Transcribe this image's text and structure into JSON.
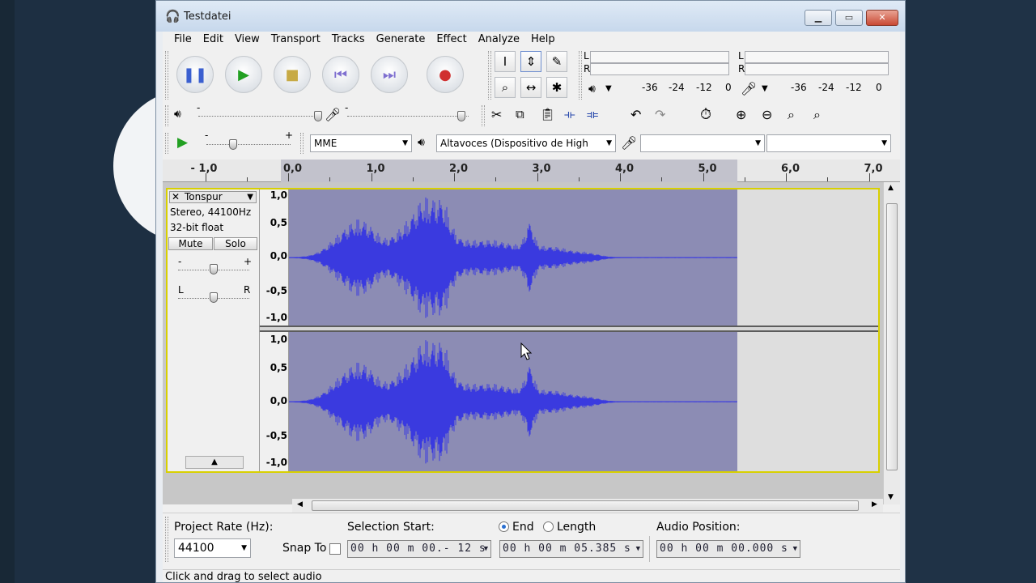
{
  "window": {
    "title": "Testdatei"
  },
  "menu": [
    "File",
    "Edit",
    "View",
    "Transport",
    "Tracks",
    "Generate",
    "Effect",
    "Analyze",
    "Help"
  ],
  "transport_buttons": [
    {
      "name": "pause-button",
      "glyph": "❚❚",
      "color": "#3a5fd0"
    },
    {
      "name": "play-button",
      "glyph": "▶",
      "color": "#22a022"
    },
    {
      "name": "stop-button",
      "glyph": "■",
      "color": "#c7aa45"
    },
    {
      "name": "skip-start-button",
      "glyph": "⏮",
      "color": "#7f70d0"
    },
    {
      "name": "skip-end-button",
      "glyph": "⏭",
      "color": "#7f70d0"
    },
    {
      "name": "record-button",
      "glyph": "●",
      "color": "#d03030"
    }
  ],
  "tools": {
    "selection": "I",
    "envelope": "⇕",
    "draw": "✎",
    "zoom": "⌕",
    "timeshift": "↔",
    "multi": "✱"
  },
  "meters": {
    "play_L": "L",
    "play_R": "R",
    "rec_L": "L",
    "rec_R": "R",
    "play_scale": [
      "-36",
      "-24",
      "-12",
      "0"
    ],
    "rec_scale": [
      "-36",
      "-24",
      "-12",
      "0"
    ]
  },
  "mixer": {
    "minus": "-",
    "plus": "+"
  },
  "device_toolbar": {
    "host": "MME",
    "output": "Altavoces (Dispositivo de High",
    "input": "",
    "channels": ""
  },
  "ruler": {
    "labels": [
      "- 1,0",
      "0,0",
      "1,0",
      "2,0",
      "3,0",
      "4,0",
      "5,0",
      "6,0",
      "7,0"
    ]
  },
  "track": {
    "name": "Tonspur",
    "info_line1": "Stereo, 44100Hz",
    "info_line2": "32-bit float",
    "mute": "Mute",
    "solo": "Solo",
    "gain_minus": "-",
    "gain_plus": "+",
    "pan_left": "L",
    "pan_right": "R",
    "scale": [
      "1,0",
      "0,5",
      "0,0",
      "-0,5",
      "-1,0"
    ]
  },
  "selection_toolbar": {
    "project_rate_label": "Project Rate (Hz):",
    "project_rate": "44100",
    "snap_to": "Snap To",
    "selection_start_label": "Selection Start:",
    "end_label": "End",
    "length_label": "Length",
    "audio_position_label": "Audio Position:",
    "selection_start": "00 h 00 m 00.- 12 s",
    "selection_end": "00 h 00 m 05.385 s",
    "audio_position": "00 h 00 m 00.000 s"
  },
  "status": "Click and drag to select audio",
  "colors": {
    "waveform": "#3a3adf",
    "selected_bg": "#8c8cb4",
    "track_border": "#d8d000"
  }
}
